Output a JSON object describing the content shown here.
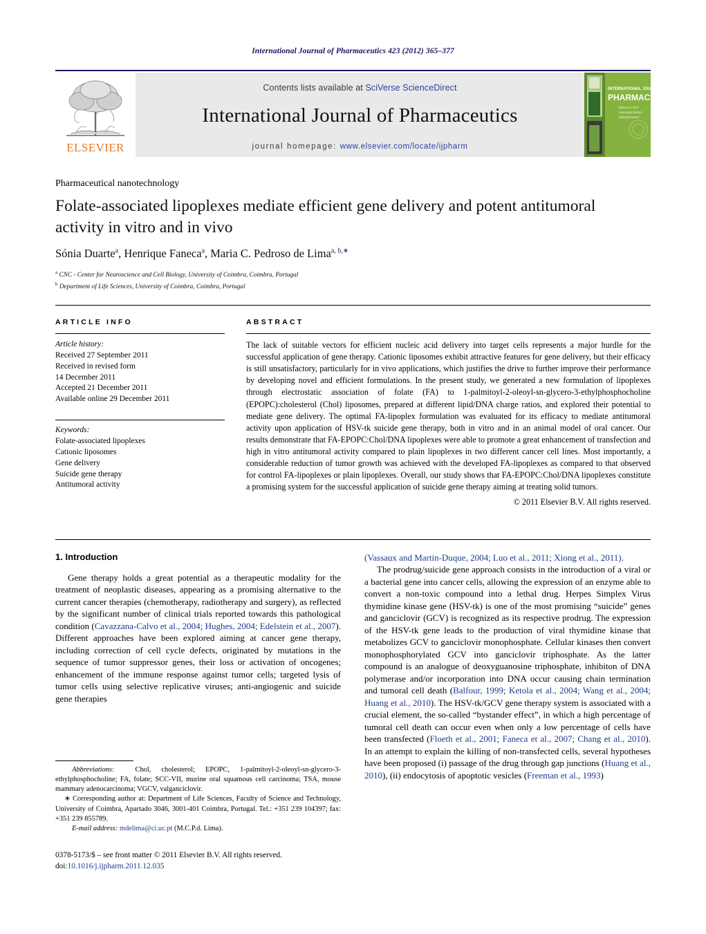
{
  "running_head": "International Journal of Pharmaceutics 423 (2012) 365–377",
  "masthead": {
    "contents_prefix": "Contents lists available at ",
    "contents_brand": "SciVerse ScienceDirect",
    "journal_title": "International Journal of Pharmaceutics",
    "homepage_prefix": "journal homepage:",
    "homepage_url": "www.elsevier.com/locate/ijpharm",
    "publisher_wordmark": "ELSEVIER",
    "publisher_color": "#e87722",
    "brand_link_color": "#2b3fa0",
    "rule_color": "#1b1464",
    "cover_title_small": "INTERNATIONAL JOURNAL OF",
    "cover_title_large": "PHARMACEUTICS",
    "cover_bg_color": "#7fae3a"
  },
  "section_label": "Pharmaceutical nanotechnology",
  "title": "Folate-associated lipoplexes mediate efficient gene delivery and potent antitumoral activity in vitro and in vivo",
  "authors": [
    {
      "name": "Sónia Duarte",
      "marks": "a"
    },
    {
      "name": "Henrique Faneca",
      "marks": "a"
    },
    {
      "name": "Maria C. Pedroso de Lima",
      "marks": "a, b,∗"
    }
  ],
  "affiliations": [
    {
      "mark": "a",
      "text": "CNC - Center for Neuroscience and Cell Biology, University of Coimbra, Coimbra, Portugal"
    },
    {
      "mark": "b",
      "text": "Department of Life Sciences, University of Coimbra, Coimbra, Portugal"
    }
  ],
  "article_info": {
    "heading": "ARTICLE INFO",
    "history_title": "Article history:",
    "history": [
      "Received 27 September 2011",
      "Received in revised form",
      "14 December 2011",
      "Accepted 21 December 2011",
      "Available online 29 December 2011"
    ],
    "keywords_title": "Keywords:",
    "keywords": [
      "Folate-associated lipoplexes",
      "Cationic liposomes",
      "Gene delivery",
      "Suicide gene therapy",
      "Antitumoral activity"
    ]
  },
  "abstract": {
    "heading": "ABSTRACT",
    "text": "The lack of suitable vectors for efficient nucleic acid delivery into target cells represents a major hurdle for the successful application of gene therapy. Cationic liposomes exhibit attractive features for gene delivery, but their efficacy is still unsatisfactory, particularly for in vivo applications, which justifies the drive to further improve their performance by developing novel and efficient formulations. In the present study, we generated a new formulation of lipoplexes through electrostatic association of folate (FA) to 1-palmitoyl-2-oleoyl-sn-glycero-3-ethylphosphocholine (EPOPC):cholesterol (Chol) liposomes, prepared at different lipid/DNA charge ratios, and explored their potential to mediate gene delivery. The optimal FA-lipoplex formulation was evaluated for its efficacy to mediate antitumoral activity upon application of HSV-tk suicide gene therapy, both in vitro and in an animal model of oral cancer. Our results demonstrate that FA-EPOPC:Chol/DNA lipoplexes were able to promote a great enhancement of transfection and high in vitro antitumoral activity compared to plain lipoplexes in two different cancer cell lines. Most importantly, a considerable reduction of tumor growth was achieved with the developed FA-lipoplexes as compared to that observed for control FA-lipoplexes or plain lipoplexes. Overall, our study shows that FA-EPOPC:Chol/DNA lipoplexes constitute a promising system for the successful application of suicide gene therapy aiming at treating solid tumors.",
    "copyright": "© 2011 Elsevier B.V. All rights reserved."
  },
  "body": {
    "intro_heading": "1. Introduction",
    "left_p1_a": "Gene therapy holds a great potential as a therapeutic modality for the treatment of neoplastic diseases, appearing as a promising alternative to the current cancer therapies (chemotherapy, radiotherapy and surgery), as reflected by the significant number of clinical trials reported towards this pathological condition (",
    "left_p1_ref1": "Cavazzana-Calvo et al., 2004; Hughes, 2004; Edelstein et al., 2007",
    "left_p1_b": "). Different approaches have been explored aiming at cancer gene therapy, including correction of cell cycle defects, originated by mutations in the sequence of tumor suppressor genes, their loss or activation of oncogenes; enhancement of the immune response against tumor cells; targeted lysis of tumor cells using selective replicative viruses; anti-angiogenic and suicide gene therapies",
    "right_p0_ref": "(Vassaux and Martin-Duque, 2004; Luo et al., 2011; Xiong et al., 2011)",
    "right_p0_tail": ".",
    "right_p1_a": "The prodrug/suicide gene approach consists in the introduction of a viral or a bacterial gene into cancer cells, allowing the expression of an enzyme able to convert a non-toxic compound into a lethal drug. Herpes Simplex Virus thymidine kinase gene (HSV-tk) is one of the most promising “suicide” genes and ganciclovir (GCV) is recognized as its respective prodrug. The expression of the HSV-tk gene leads to the production of viral thymidine kinase that metabolizes GCV to ganciclovir monophosphate. Cellular kinases then convert monophosphorylated GCV into ganciclovir triphosphate. As the latter compound is an analogue of deoxyguanosine triphosphate, inhibiton of DNA polymerase and/or incorporation into DNA occur causing chain termination and tumoral cell death (",
    "right_p1_ref1": "Balfour, 1999; Ketola et al., 2004; Wang et al., 2004; Huang et al., 2010",
    "right_p1_b": "). The HSV-tk/GCV gene therapy system is associated with a crucial element, the so-called “bystander effect”, in which a high percentage of tumoral cell death can occur even when only a low percentage of cells have been transfected (",
    "right_p1_ref2": "Floeth et al., 2001; Faneca et al., 2007; Chang et al., 2010",
    "right_p1_c": "). In an attempt to explain the killing of non-transfected cells, several hypotheses have been proposed (i) passage of the drug through gap junctions (",
    "right_p1_ref3": "Huang et al., 2010",
    "right_p1_d": "), (ii) endocytosis of apoptotic vesicles (",
    "right_p1_ref4": "Freeman et al., 1993",
    "right_p1_e": ")"
  },
  "footnotes": {
    "abbrev_label": "Abbreviations:",
    "abbrev_text": "Chol, cholesterol; EPOPC, 1-palmitoyl-2-oleoyl-sn-glycero-3-ethylphosphocholine; FA, folate; SCC-VII, murine oral squamous cell carcinoma; TSA, mouse mammary adenocarcinoma; VGCV, valganciclovir.",
    "corresponding_mark": "∗",
    "corresponding_text": "Corresponding author at: Department of Life Sciences, Faculty of Science and Technology, University of Coimbra, Apartado 3046, 3001-401 Coimbra, Portugal. Tel.: +351 239 104397; fax: +351 239 855789.",
    "email_label": "E-mail address:",
    "email_address": "mdelima@ci.uc.pt",
    "email_suffix": "(M.C.P.d. Lima)."
  },
  "imprint": {
    "line1": "0378-5173/$ – see front matter © 2011 Elsevier B.V. All rights reserved.",
    "doi_label": "doi:",
    "doi_value": "10.1016/j.ijpharm.2011.12.035"
  }
}
